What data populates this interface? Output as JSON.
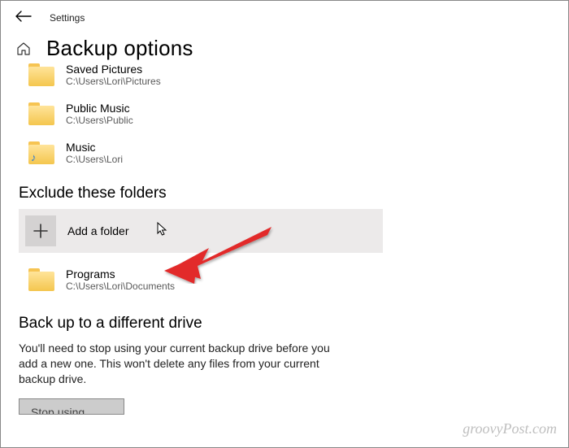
{
  "header": {
    "settings_label": "Settings"
  },
  "page": {
    "title": "Backup options"
  },
  "folders": [
    {
      "name": "Saved Pictures",
      "path": "C:\\Users\\Lori\\Pictures",
      "icon": "folder"
    },
    {
      "name": "Public Music",
      "path": "C:\\Users\\Public",
      "icon": "folder"
    },
    {
      "name": "Music",
      "path": "C:\\Users\\Lori",
      "icon": "music-folder"
    }
  ],
  "exclude": {
    "heading": "Exclude these folders",
    "add_label": "Add a folder",
    "items": [
      {
        "name": "Programs",
        "path": "C:\\Users\\Lori\\Documents",
        "icon": "folder"
      }
    ]
  },
  "different_drive": {
    "heading": "Back up to a different drive",
    "body": "You'll need to stop using your current backup drive before you add a new one. This won't delete any files from your current backup drive.",
    "button": "Stop using drive"
  },
  "watermark": "groovyPost.com"
}
